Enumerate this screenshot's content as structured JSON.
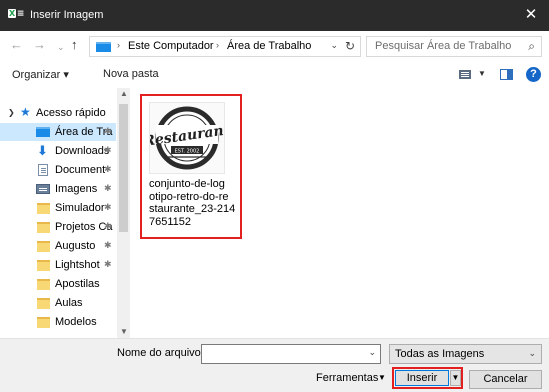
{
  "window": {
    "app_icon_text": "X",
    "title": "Inserir Imagem",
    "close_symbol": "✕"
  },
  "address": {
    "back": "←",
    "forward": "→",
    "history": "⌄",
    "up": "↑",
    "crumbs": [
      "Este Computador",
      "Área de Trabalho"
    ],
    "separator": "›",
    "dropdown": "⌄",
    "refresh": "↻",
    "search_placeholder": "Pesquisar Área de Trabalho",
    "search_icon": "⌕"
  },
  "toolbar": {
    "organize": "Organizar ▾",
    "new_folder": "Nova pasta",
    "help": "?"
  },
  "nav": {
    "items": [
      {
        "label": "Acesso rápido",
        "icon": "star-icon",
        "expanded": true
      },
      {
        "label": "Área de Tra",
        "icon": "desktop-folder-icon",
        "pinned": true,
        "selected": true
      },
      {
        "label": "Downloads",
        "icon": "download-icon",
        "pinned": true
      },
      {
        "label": "Document",
        "icon": "document-icon",
        "pinned": true
      },
      {
        "label": "Imagens",
        "icon": "images-icon",
        "pinned": true
      },
      {
        "label": "Simulador",
        "icon": "folder-icon",
        "pinned": true
      },
      {
        "label": "Projetos Ca",
        "icon": "folder-icon",
        "pinned": true
      },
      {
        "label": "Augusto",
        "icon": "folder-icon",
        "pinned": true
      },
      {
        "label": "Lightshot",
        "icon": "folder-icon",
        "pinned": true
      },
      {
        "label": "Apostilas",
        "icon": "folder-icon",
        "pinned": false
      },
      {
        "label": "Aulas",
        "icon": "folder-icon",
        "pinned": false
      },
      {
        "label": "Modelos",
        "icon": "folder-icon",
        "pinned": false
      }
    ],
    "pin_symbol": "✱",
    "scroll_up": "▲",
    "scroll_down": "▼"
  },
  "content": {
    "file": {
      "name_lines": [
        "conjunto-de-log",
        "otipo-retro-do-re",
        "staurante_23-214",
        "7651152"
      ],
      "thumbnail_logo_text": "Restaurant",
      "thumbnail_est_text": "EST. 2002"
    }
  },
  "bottom": {
    "filename_label": "Nome do arquivo:",
    "filename_value": "",
    "filter_value": "Todas as Imagens",
    "tools_label": "Ferramentas",
    "insert_label": "Inserir",
    "cancel_label": "Cancelar",
    "dropdown": "⌄",
    "split_arrow": "▼"
  },
  "colors": {
    "titlebar": "#2b2b2b",
    "selection": "#cce8ff",
    "highlight_border": "#e32020",
    "accent": "#0078d7"
  }
}
